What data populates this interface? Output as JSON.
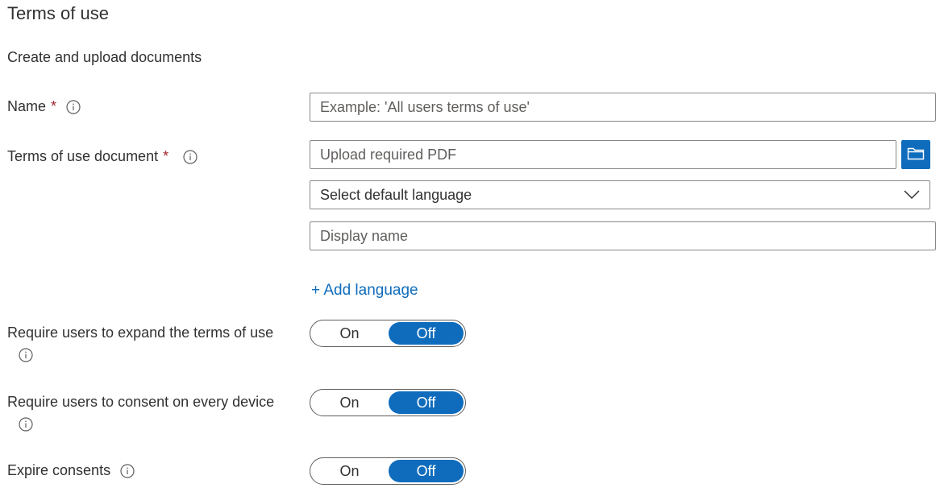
{
  "title": "Terms of use",
  "subtitle": "Create and upload documents",
  "name_field": {
    "label": "Name",
    "required_mark": "*",
    "placeholder": "Example: 'All users terms of use'"
  },
  "document_field": {
    "label": "Terms of use document",
    "required_mark": "*",
    "upload_placeholder": "Upload required PDF",
    "language_select": "Select default language",
    "display_name_placeholder": "Display name"
  },
  "add_language_label": "+ Add language",
  "toggles": [
    {
      "label": "Require users to expand the terms of use",
      "on_label": "On",
      "off_label": "Off",
      "selected": "Off"
    },
    {
      "label": "Require users to consent on every device",
      "on_label": "On",
      "off_label": "Off",
      "selected": "Off"
    },
    {
      "label": "Expire consents",
      "on_label": "On",
      "off_label": "Off",
      "selected": "Off"
    }
  ],
  "colors": {
    "accent": "#0f6cbd",
    "required": "#a4262c",
    "text": "#323130",
    "border": "#8a8886"
  },
  "icons": {
    "info": "info-icon",
    "browse": "folder-icon",
    "dropdown": "chevron-down-icon"
  }
}
